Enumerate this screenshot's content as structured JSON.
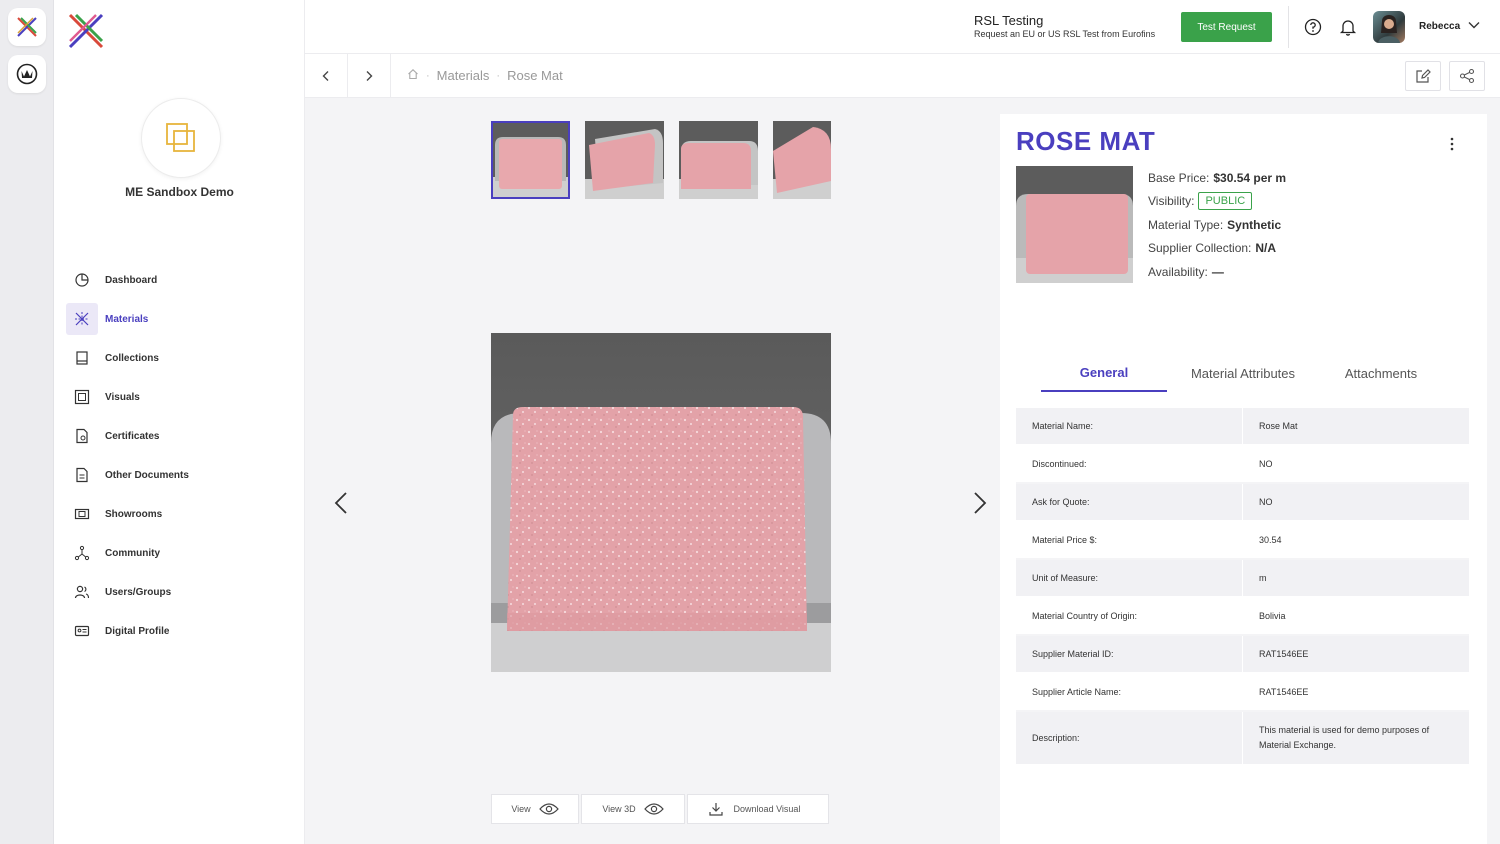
{
  "org": {
    "name": "ME Sandbox Demo"
  },
  "colors": {
    "accent": "#4a3fbf",
    "success": "#3aa24a",
    "thumbnail_pink": "#e9a8ad"
  },
  "sidebar": {
    "items": [
      {
        "label": "Dashboard",
        "icon": "pie-chart-icon"
      },
      {
        "label": "Materials",
        "icon": "materials-icon",
        "active": true
      },
      {
        "label": "Collections",
        "icon": "book-icon"
      },
      {
        "label": "Visuals",
        "icon": "image-frame-icon"
      },
      {
        "label": "Certificates",
        "icon": "certificate-icon"
      },
      {
        "label": "Other Documents",
        "icon": "document-icon"
      },
      {
        "label": "Showrooms",
        "icon": "showroom-icon"
      },
      {
        "label": "Community",
        "icon": "network-icon"
      },
      {
        "label": "Users/Groups",
        "icon": "users-icon"
      },
      {
        "label": "Digital Profile",
        "icon": "id-card-icon"
      }
    ]
  },
  "header": {
    "rsl_title": "RSL Testing",
    "rsl_subtitle": "Request an EU or US RSL Test from Eurofins",
    "test_button": "Test Request",
    "user_name": "Rebecca"
  },
  "breadcrumb": {
    "items": [
      "Materials",
      "Rose Mat"
    ]
  },
  "gallery": {
    "tools": [
      {
        "label": "View",
        "icon": "eye-icon"
      },
      {
        "label": "View 3D",
        "icon": "eye-icon"
      },
      {
        "label": "Download Visual",
        "icon": "download-icon"
      }
    ]
  },
  "material": {
    "title": "ROSE MAT",
    "info": {
      "base_price_label": "Base Price:",
      "base_price": "$30.54 per m",
      "visibility_label": "Visibility:",
      "visibility": "PUBLIC",
      "type_label": "Material Type:",
      "type": "Synthetic",
      "collection_label": "Supplier Collection:",
      "collection": "N/A",
      "availability_label": "Availability:",
      "availability": "—"
    },
    "tabs": [
      "General",
      "Material Attributes",
      "Attachments"
    ],
    "attributes": [
      {
        "key": "Material Name:",
        "value": "Rose Mat"
      },
      {
        "key": "Discontinued:",
        "value": "NO"
      },
      {
        "key": "Ask for Quote:",
        "value": "NO"
      },
      {
        "key": "Material Price $:",
        "value": "30.54"
      },
      {
        "key": "Unit of Measure:",
        "value": "m"
      },
      {
        "key": "Material Country of Origin:",
        "value": "Bolivia"
      },
      {
        "key": "Supplier Material ID:",
        "value": "RAT1546EE"
      },
      {
        "key": "Supplier Article Name:",
        "value": "RAT1546EE"
      },
      {
        "key": "Description:",
        "value": "This material is used for demo purposes of Material Exchange."
      }
    ]
  }
}
